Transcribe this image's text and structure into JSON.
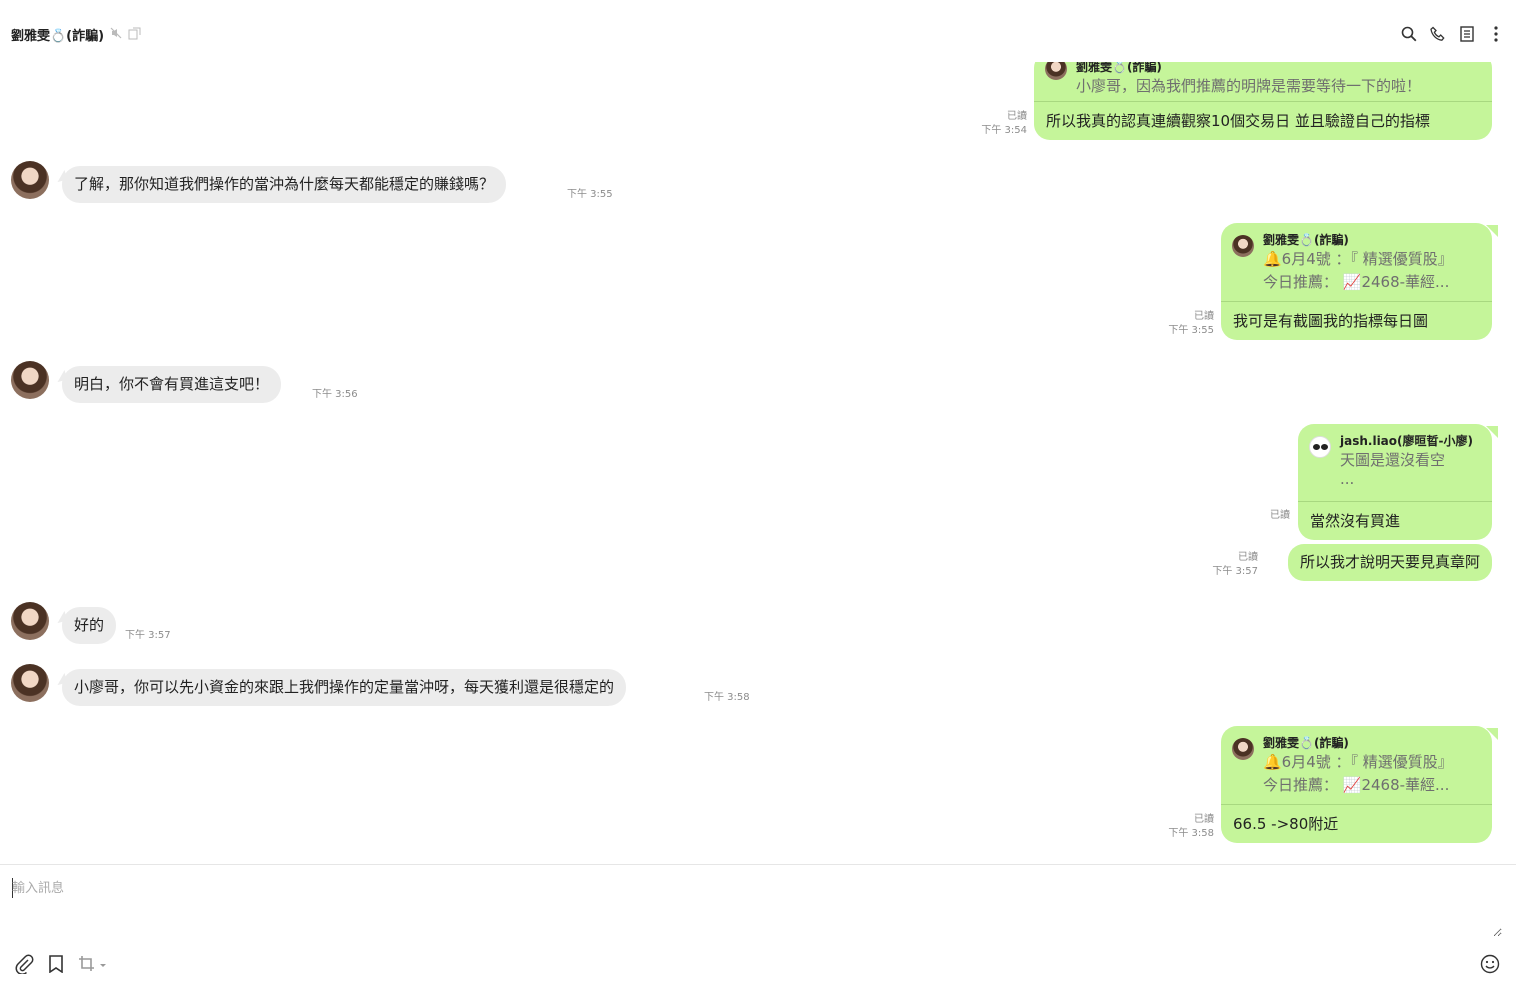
{
  "header": {
    "title": "劉雅雯💍(詐騙)",
    "actions": [
      "search-icon",
      "phone-icon",
      "notes-icon",
      "more-icon"
    ]
  },
  "messages": {
    "m1": {
      "reply_name": "劉雅雯💍(詐騙)",
      "reply_text": "小廖哥，因為我們推薦的明牌是需要等待一下的啦！",
      "text": "所以我真的認真連續觀察10個交易日 並且驗證自己的指標",
      "read": "已讀",
      "time": "下午 3:54"
    },
    "m2": {
      "text": "了解，那你知道我們操作的當沖為什麼每天都能穩定的賺錢嗎？",
      "time": "下午 3:55"
    },
    "m3": {
      "reply_name": "劉雅雯💍(詐騙)",
      "reply_line1": "🔔6月4號 ：『 精選優質股』",
      "reply_line2": "今日推薦： 📈2468-華經...",
      "text": "我可是有截圖我的指標每日圖",
      "read": "已讀",
      "time": "下午 3:55"
    },
    "m4": {
      "text": "明白，你不會有買進這支吧！",
      "time": "下午 3:56"
    },
    "m5": {
      "reply_name": "jash.liao(廖晅晢-小廖)",
      "reply_line1": "天圖是還沒看空",
      "reply_line2": "...",
      "text": "當然沒有買進",
      "read": "已讀"
    },
    "m6": {
      "text": "所以我才說明天要見真章阿",
      "read": "已讀",
      "time": "下午 3:57"
    },
    "m7": {
      "text": "好的",
      "time": "下午 3:57"
    },
    "m8": {
      "text": "小廖哥，你可以先小資金的來跟上我們操作的定量當沖呀，每天獲利還是很穩定的",
      "time": "下午 3:58"
    },
    "m9": {
      "reply_name": "劉雅雯💍(詐騙)",
      "reply_line1": "🔔6月4號 ：『 精選優質股』",
      "reply_line2": "今日推薦： 📈2468-華經...",
      "text": "66.5 ->80附近",
      "read": "已讀",
      "time": "下午 3:58"
    }
  },
  "input": {
    "placeholder": "輸入訊息"
  },
  "toolbar": [
    "paperclip-icon",
    "bookmark-icon",
    "crop-icon",
    "emoji-icon"
  ]
}
